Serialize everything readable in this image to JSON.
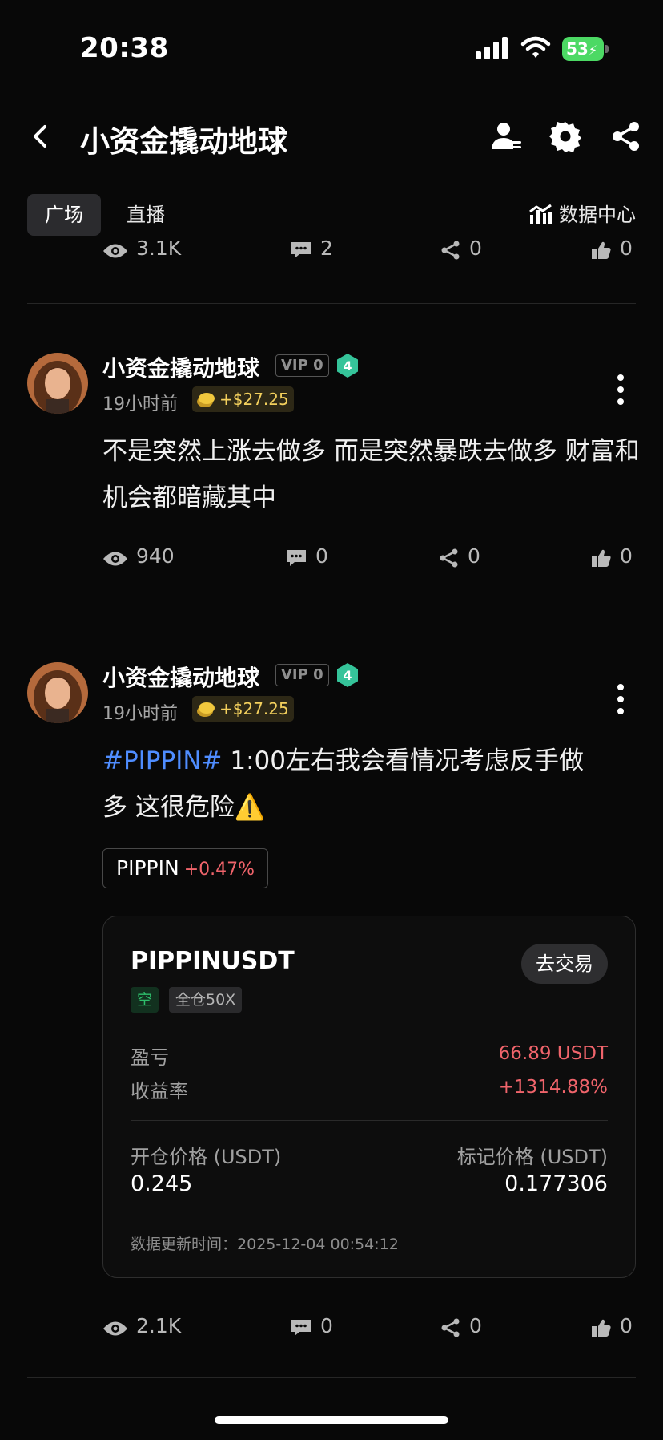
{
  "status_bar": {
    "time": "20:38",
    "battery": "53"
  },
  "nav": {
    "title": "小资金撬动地球"
  },
  "tabs": [
    {
      "label": "广场"
    },
    {
      "label": "直播"
    }
  ],
  "data_center": {
    "label": "数据中心"
  },
  "top_stats": {
    "views": "3.1K",
    "comments": "2",
    "shares": "0",
    "likes": "0"
  },
  "posts": [
    {
      "author": "小资金撬动地球",
      "vip": "VIP 0",
      "level": "4",
      "time_ago": "19小时前",
      "earnings": "+$27.25",
      "text": "不是突然上涨去做多 而是突然暴跌去做多 财富和机会都暗藏其中",
      "stats": {
        "views": "940",
        "comments": "0",
        "shares": "0",
        "likes": "0"
      }
    },
    {
      "author": "小资金撬动地球",
      "vip": "VIP 0",
      "level": "4",
      "time_ago": "19小时前",
      "earnings": "+$27.25",
      "hashtag": "#PIPPIN#",
      "text_line1": " 1:00左右我会看情况考虑反手做",
      "text_line2": "多 这很危险⚠️",
      "coin_chip": {
        "symbol": "PIPPIN",
        "change": "+0.47%"
      },
      "trade": {
        "symbol": "PIPPINUSDT",
        "action_label": "去交易",
        "side": "空",
        "margin": "全仓50X",
        "pnl_label": "盈亏",
        "pnl_value": "66.89 USDT",
        "roi_label": "收益率",
        "roi_value": "+1314.88%",
        "open_price_label": "开仓价格 (USDT)",
        "open_price": "0.245",
        "mark_price_label": "标记价格 (USDT)",
        "mark_price": "0.177306",
        "update_label": "数据更新时间：",
        "update_time": "2025-12-04 00:54:12"
      },
      "stats": {
        "views": "2.1K",
        "comments": "0",
        "shares": "0",
        "likes": "0"
      }
    }
  ],
  "colors": {
    "background": "#080808",
    "hashtag": "#4f8dff",
    "profit_red": "#f0646b",
    "short_green": "#2ebd6b",
    "earn_gold": "#f3d05d"
  },
  "icons": [
    "back-icon",
    "user-icon",
    "settings-icon",
    "share-icon",
    "chart-icon",
    "eye-icon",
    "comment-icon",
    "share-icon",
    "thumbs-up-icon",
    "more-icon",
    "coin-icon",
    "level-badge-icon"
  ]
}
